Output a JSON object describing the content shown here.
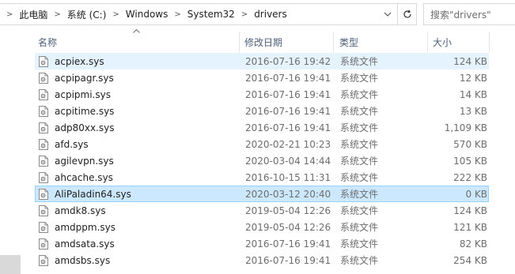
{
  "address_bar": {
    "breadcrumbs": [
      "此电脑",
      "系统 (C:)",
      "Windows",
      "System32",
      "drivers"
    ],
    "separator": ">",
    "dropdown_icon": "chevron-down-icon",
    "refresh_icon": "refresh-icon"
  },
  "search": {
    "placeholder": "搜索\"drivers\""
  },
  "columns": {
    "name": "名称",
    "date": "修改日期",
    "type": "类型",
    "size": "大小",
    "sorted_column": "name"
  },
  "files": [
    {
      "name": "acpiex.sys",
      "date": "2016-07-16 19:42",
      "type": "系统文件",
      "size": "124 KB",
      "state": "hover"
    },
    {
      "name": "acpipagr.sys",
      "date": "2016-07-16 19:41",
      "type": "系统文件",
      "size": "12 KB",
      "state": ""
    },
    {
      "name": "acpipmi.sys",
      "date": "2016-07-16 19:41",
      "type": "系统文件",
      "size": "14 KB",
      "state": ""
    },
    {
      "name": "acpitime.sys",
      "date": "2016-07-16 19:41",
      "type": "系统文件",
      "size": "13 KB",
      "state": ""
    },
    {
      "name": "adp80xx.sys",
      "date": "2016-07-16 19:41",
      "type": "系统文件",
      "size": "1,109 KB",
      "state": ""
    },
    {
      "name": "afd.sys",
      "date": "2020-02-21 10:23",
      "type": "系统文件",
      "size": "570 KB",
      "state": ""
    },
    {
      "name": "agilevpn.sys",
      "date": "2020-03-04 14:44",
      "type": "系统文件",
      "size": "105 KB",
      "state": ""
    },
    {
      "name": "ahcache.sys",
      "date": "2016-10-15 11:31",
      "type": "系统文件",
      "size": "222 KB",
      "state": ""
    },
    {
      "name": "AliPaladin64.sys",
      "date": "2020-03-12 20:40",
      "type": "系统文件",
      "size": "0 KB",
      "state": "selected"
    },
    {
      "name": "amdk8.sys",
      "date": "2019-05-04 12:26",
      "type": "系统文件",
      "size": "124 KB",
      "state": ""
    },
    {
      "name": "amdppm.sys",
      "date": "2019-05-04 12:26",
      "type": "系统文件",
      "size": "121 KB",
      "state": ""
    },
    {
      "name": "amdsata.sys",
      "date": "2016-07-16 19:41",
      "type": "系统文件",
      "size": "82 KB",
      "state": ""
    },
    {
      "name": "amdsbs.sys",
      "date": "2016-07-16 19:41",
      "type": "系统文件",
      "size": "254 KB",
      "state": ""
    }
  ],
  "colors": {
    "hover_bg": "#e5f3ff",
    "selected_bg": "#cce8ff",
    "selected_border": "#99d1ff",
    "header_text": "#4c607a"
  }
}
